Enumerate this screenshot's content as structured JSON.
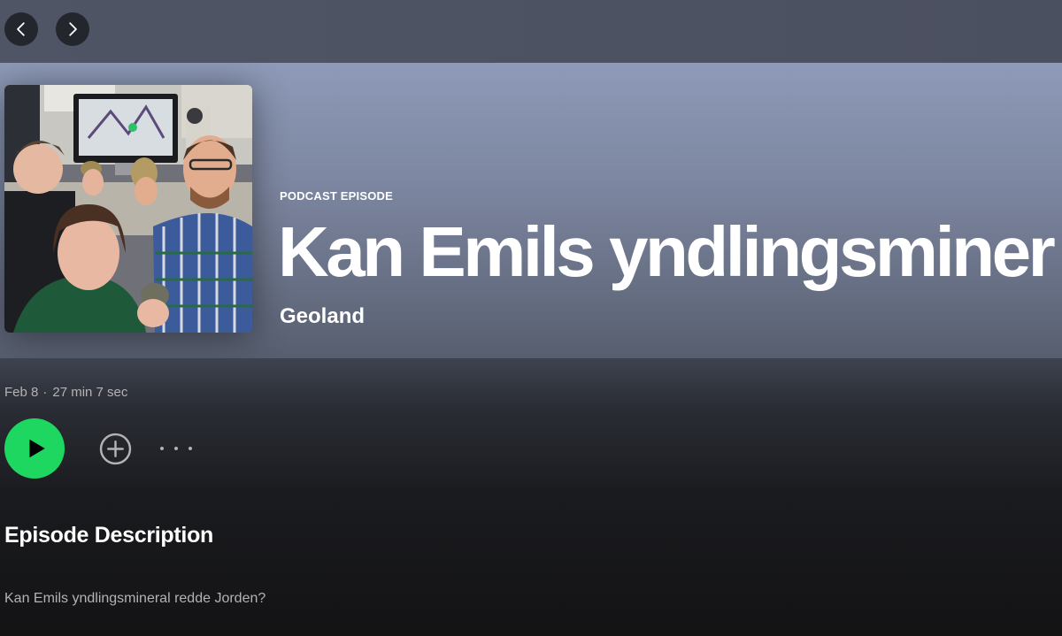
{
  "navigation": {
    "back_icon": "chevron-left-icon",
    "forward_icon": "chevron-right-icon"
  },
  "episode": {
    "type_label": "PODCAST EPISODE",
    "title": "Kan Emils yndlingsminer",
    "show_name": "Geoland",
    "date": "Feb 8",
    "separator": "·",
    "duration": "27 min 7 sec",
    "cover_alt": "Episode cover art"
  },
  "actions": {
    "play_icon": "play-icon",
    "add_icon": "add-circle-icon",
    "more_icon": "more-options-icon",
    "play_color": "#1ed760"
  },
  "description": {
    "heading": "Episode Description",
    "text": "Kan Emils yndlingsmineral redde Jorden?"
  }
}
